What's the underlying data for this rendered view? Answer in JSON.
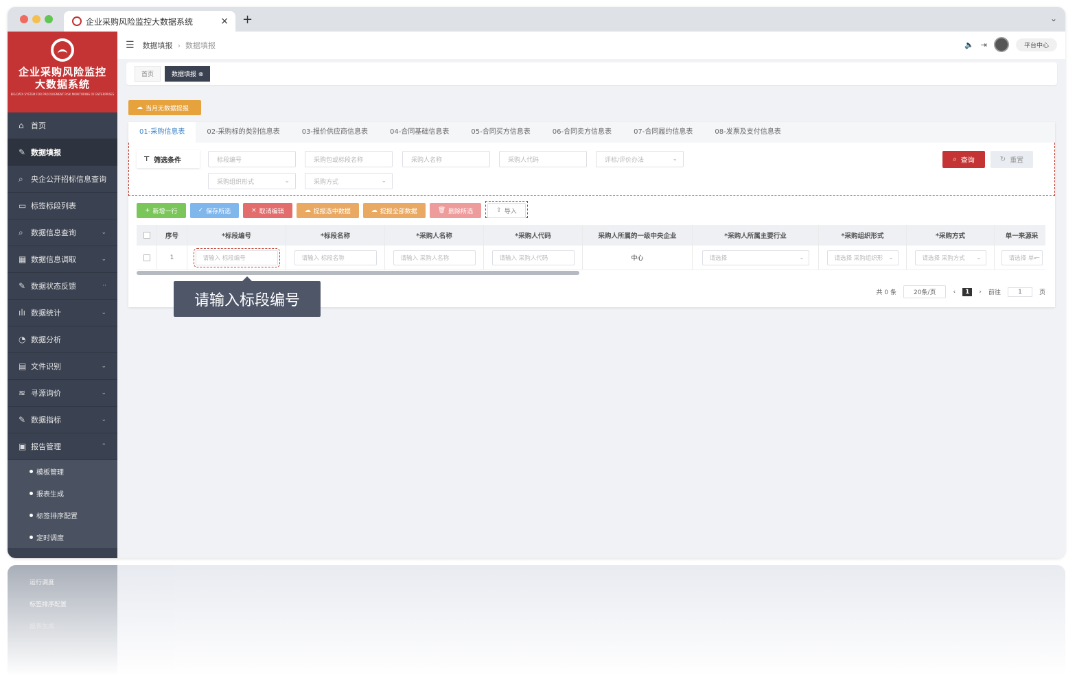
{
  "browser": {
    "tab_title": "企业采购风险监控大数据系统",
    "close": "×",
    "new_tab": "+",
    "chevron": "⌄"
  },
  "brand": {
    "title_line1": "企业采购风险监控",
    "title_line2": "大数据系统",
    "subtitle": "BIG DATA SYSTEM FOR PROCUREMENT RISK MONITORING OF ENTERPRISES"
  },
  "sidebar": {
    "items": [
      {
        "label": "首页",
        "icon": "⌂"
      },
      {
        "label": "数据填报",
        "icon": "✎"
      },
      {
        "label": "央企公开招标信息查询",
        "icon": "⌕"
      },
      {
        "label": "标签标段列表",
        "icon": "▭"
      },
      {
        "label": "数据信息查询",
        "icon": "⌕",
        "arrow": "⌄"
      },
      {
        "label": "数据信息调取",
        "icon": "▦",
        "arrow": "⌄"
      },
      {
        "label": "数据状态反馈",
        "icon": "✎",
        "arrow": "··"
      },
      {
        "label": "数据统计",
        "icon": "ılı",
        "arrow": "⌄"
      },
      {
        "label": "数据分析",
        "icon": "◔"
      },
      {
        "label": "文件识别",
        "icon": "▤",
        "arrow": "⌄"
      },
      {
        "label": "寻源询价",
        "icon": "≋",
        "arrow": "⌄"
      },
      {
        "label": "数据指标",
        "icon": "✎",
        "arrow": "⌄"
      },
      {
        "label": "报告管理",
        "icon": "▣",
        "arrow": "⌃"
      }
    ],
    "subitems": [
      "模板管理",
      "报表生成",
      "标签排序配置",
      "定时调度"
    ]
  },
  "topbar": {
    "breadcrumb1": "数据填报",
    "breadcrumb2": "数据填报",
    "platform": "平台中心"
  },
  "tags": {
    "home": "首页",
    "current": "数据填报 ⊗"
  },
  "notice": "当月无数据提报",
  "tabs": [
    "01-采购信息表",
    "02-采购标的类别信息表",
    "03-报价供应商信息表",
    "04-合同基础信息表",
    "05-合同买方信息表",
    "06-合同卖方信息表",
    "07-合同履约信息表",
    "08-发票及支付信息表"
  ],
  "filter": {
    "label": "筛选条件",
    "placeholders": [
      "标段编号",
      "采购包或标段名称",
      "采购人名称",
      "采购人代码",
      "评标/评价办法",
      "采购组织形式",
      "采购方式"
    ],
    "search": "查询",
    "reset": "重置"
  },
  "toolbar": [
    "新增一行",
    "保存所选",
    "取消编辑",
    "提报选中数据",
    "提报全部数据",
    "删除所选",
    "导入"
  ],
  "table": {
    "headers": [
      "序号",
      "*标段编号",
      "*标段名称",
      "*采购人名称",
      "*采购人代码",
      "采购人所属的一级中央企业",
      "*采购人所属主要行业",
      "*采购组织形式",
      "*采购方式",
      "单一来源采"
    ],
    "row": {
      "index": "1",
      "inputs": [
        "请输入 标段编号",
        "请输入 标段名称",
        "请输入 采购人名称",
        "请输入 采购人代码"
      ],
      "center": "中心",
      "selects": [
        "请选择",
        "请选择 采购组织形",
        "请选择 采购方式",
        "请选择 单一"
      ]
    }
  },
  "tooltip": "请输入标段编号",
  "pager": {
    "total": "共 0 条",
    "size": "20条/页",
    "page": "1",
    "goto": "前往",
    "goto_val": "1",
    "unit": "页"
  },
  "reflection": [
    "运行调度",
    "标签排序配置",
    "报表生成"
  ]
}
